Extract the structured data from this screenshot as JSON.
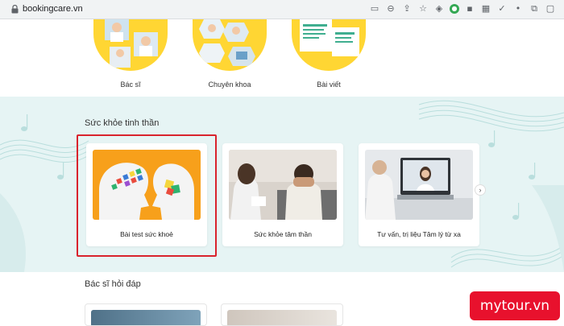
{
  "browser": {
    "url": "bookingcare.vn"
  },
  "categories": [
    {
      "label": "Bác sĩ"
    },
    {
      "label": "Chuyên khoa"
    },
    {
      "label": "Bài viết"
    }
  ],
  "mental_health": {
    "title": "Sức khỏe tinh thần",
    "cards": [
      {
        "label": "Bài test sức khoẻ"
      },
      {
        "label": "Sức khỏe tâm thần"
      },
      {
        "label": "Tư vấn, trị liệu Tâm lý từ xa"
      }
    ]
  },
  "doctor_qa": {
    "title": "Bác sĩ hỏi đáp"
  },
  "watermark": {
    "text": "mytour.vn"
  },
  "colors": {
    "accent_yellow": "#ffd633",
    "section_bg": "#e6f4f4",
    "highlight_red": "#d9232d",
    "card1_orange": "#f7a01b",
    "watermark_red": "#e8112d"
  },
  "icons": [
    "lock-icon",
    "screen-cast-icon",
    "zoom-icon",
    "star-icon",
    "extension-icon",
    "puzzle-icon",
    "chevron-right-icon"
  ]
}
